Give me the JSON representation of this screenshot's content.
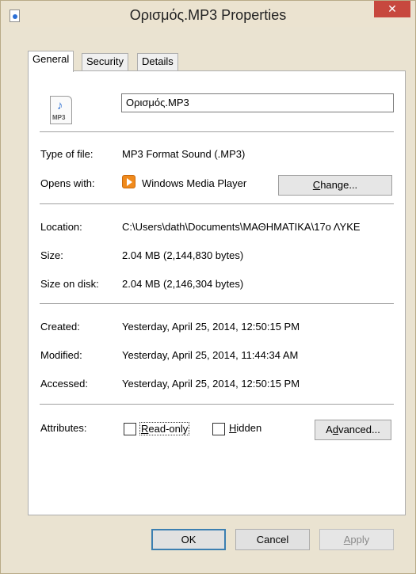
{
  "window": {
    "title": "Ορισμός.MP3 Properties",
    "close_glyph": "✕"
  },
  "tabs": [
    {
      "label": "General",
      "active": true
    },
    {
      "label": "Security",
      "active": false
    },
    {
      "label": "Details",
      "active": false
    }
  ],
  "general": {
    "file_icon_label": "MP3",
    "file_name": "Ορισμός.MP3",
    "type_label": "Type of file:",
    "type_value": "MP3 Format Sound (.MP3)",
    "opens_label": "Opens with:",
    "opens_value": "Windows Media Player",
    "change_button": "Change...",
    "location_label": "Location:",
    "location_value": "C:\\Users\\dath\\Documents\\ΜΑΘΗΜΑΤΙΚΑ\\17ο ΛΥΚΕ",
    "size_label": "Size:",
    "size_value": "2.04 MB (2,144,830 bytes)",
    "size_on_disk_label": "Size on disk:",
    "size_on_disk_value": "2.04 MB (2,146,304 bytes)",
    "created_label": "Created:",
    "created_value": "Yesterday, April 25, 2014, 12:50:15 PM",
    "modified_label": "Modified:",
    "modified_value": "Yesterday, April 25, 2014, 11:44:34 AM",
    "accessed_label": "Accessed:",
    "accessed_value": "Yesterday, April 25, 2014, 12:50:15 PM",
    "attributes_label": "Attributes:",
    "readonly_label": "Read-only",
    "readonly_checked": false,
    "hidden_label": "Hidden",
    "hidden_checked": false,
    "advanced_button": "Advanced..."
  },
  "footer": {
    "ok": "OK",
    "cancel": "Cancel",
    "apply": "Apply"
  },
  "colors": {
    "window_frame": "#eae3d1",
    "close_button": "#c7483e",
    "default_button_border": "#3c7fb1"
  }
}
